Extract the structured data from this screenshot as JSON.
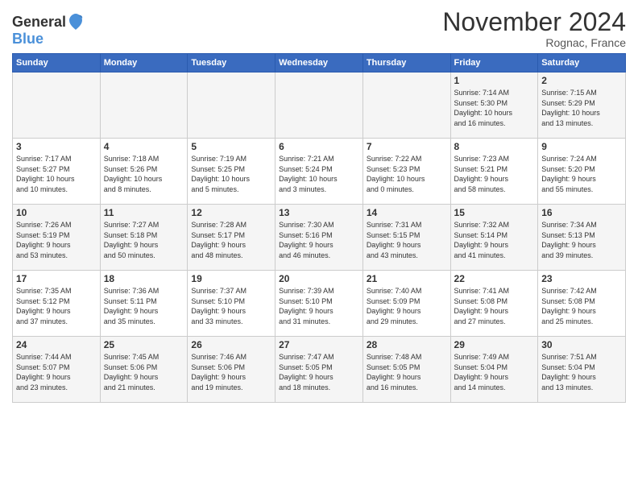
{
  "header": {
    "logo_general": "General",
    "logo_blue": "Blue",
    "title": "November 2024",
    "location": "Rognac, France"
  },
  "weekdays": [
    "Sunday",
    "Monday",
    "Tuesday",
    "Wednesday",
    "Thursday",
    "Friday",
    "Saturday"
  ],
  "weeks": [
    [
      {
        "day": "",
        "info": ""
      },
      {
        "day": "",
        "info": ""
      },
      {
        "day": "",
        "info": ""
      },
      {
        "day": "",
        "info": ""
      },
      {
        "day": "",
        "info": ""
      },
      {
        "day": "1",
        "info": "Sunrise: 7:14 AM\nSunset: 5:30 PM\nDaylight: 10 hours\nand 16 minutes."
      },
      {
        "day": "2",
        "info": "Sunrise: 7:15 AM\nSunset: 5:29 PM\nDaylight: 10 hours\nand 13 minutes."
      }
    ],
    [
      {
        "day": "3",
        "info": "Sunrise: 7:17 AM\nSunset: 5:27 PM\nDaylight: 10 hours\nand 10 minutes."
      },
      {
        "day": "4",
        "info": "Sunrise: 7:18 AM\nSunset: 5:26 PM\nDaylight: 10 hours\nand 8 minutes."
      },
      {
        "day": "5",
        "info": "Sunrise: 7:19 AM\nSunset: 5:25 PM\nDaylight: 10 hours\nand 5 minutes."
      },
      {
        "day": "6",
        "info": "Sunrise: 7:21 AM\nSunset: 5:24 PM\nDaylight: 10 hours\nand 3 minutes."
      },
      {
        "day": "7",
        "info": "Sunrise: 7:22 AM\nSunset: 5:23 PM\nDaylight: 10 hours\nand 0 minutes."
      },
      {
        "day": "8",
        "info": "Sunrise: 7:23 AM\nSunset: 5:21 PM\nDaylight: 9 hours\nand 58 minutes."
      },
      {
        "day": "9",
        "info": "Sunrise: 7:24 AM\nSunset: 5:20 PM\nDaylight: 9 hours\nand 55 minutes."
      }
    ],
    [
      {
        "day": "10",
        "info": "Sunrise: 7:26 AM\nSunset: 5:19 PM\nDaylight: 9 hours\nand 53 minutes."
      },
      {
        "day": "11",
        "info": "Sunrise: 7:27 AM\nSunset: 5:18 PM\nDaylight: 9 hours\nand 50 minutes."
      },
      {
        "day": "12",
        "info": "Sunrise: 7:28 AM\nSunset: 5:17 PM\nDaylight: 9 hours\nand 48 minutes."
      },
      {
        "day": "13",
        "info": "Sunrise: 7:30 AM\nSunset: 5:16 PM\nDaylight: 9 hours\nand 46 minutes."
      },
      {
        "day": "14",
        "info": "Sunrise: 7:31 AM\nSunset: 5:15 PM\nDaylight: 9 hours\nand 43 minutes."
      },
      {
        "day": "15",
        "info": "Sunrise: 7:32 AM\nSunset: 5:14 PM\nDaylight: 9 hours\nand 41 minutes."
      },
      {
        "day": "16",
        "info": "Sunrise: 7:34 AM\nSunset: 5:13 PM\nDaylight: 9 hours\nand 39 minutes."
      }
    ],
    [
      {
        "day": "17",
        "info": "Sunrise: 7:35 AM\nSunset: 5:12 PM\nDaylight: 9 hours\nand 37 minutes."
      },
      {
        "day": "18",
        "info": "Sunrise: 7:36 AM\nSunset: 5:11 PM\nDaylight: 9 hours\nand 35 minutes."
      },
      {
        "day": "19",
        "info": "Sunrise: 7:37 AM\nSunset: 5:10 PM\nDaylight: 9 hours\nand 33 minutes."
      },
      {
        "day": "20",
        "info": "Sunrise: 7:39 AM\nSunset: 5:10 PM\nDaylight: 9 hours\nand 31 minutes."
      },
      {
        "day": "21",
        "info": "Sunrise: 7:40 AM\nSunset: 5:09 PM\nDaylight: 9 hours\nand 29 minutes."
      },
      {
        "day": "22",
        "info": "Sunrise: 7:41 AM\nSunset: 5:08 PM\nDaylight: 9 hours\nand 27 minutes."
      },
      {
        "day": "23",
        "info": "Sunrise: 7:42 AM\nSunset: 5:08 PM\nDaylight: 9 hours\nand 25 minutes."
      }
    ],
    [
      {
        "day": "24",
        "info": "Sunrise: 7:44 AM\nSunset: 5:07 PM\nDaylight: 9 hours\nand 23 minutes."
      },
      {
        "day": "25",
        "info": "Sunrise: 7:45 AM\nSunset: 5:06 PM\nDaylight: 9 hours\nand 21 minutes."
      },
      {
        "day": "26",
        "info": "Sunrise: 7:46 AM\nSunset: 5:06 PM\nDaylight: 9 hours\nand 19 minutes."
      },
      {
        "day": "27",
        "info": "Sunrise: 7:47 AM\nSunset: 5:05 PM\nDaylight: 9 hours\nand 18 minutes."
      },
      {
        "day": "28",
        "info": "Sunrise: 7:48 AM\nSunset: 5:05 PM\nDaylight: 9 hours\nand 16 minutes."
      },
      {
        "day": "29",
        "info": "Sunrise: 7:49 AM\nSunset: 5:04 PM\nDaylight: 9 hours\nand 14 minutes."
      },
      {
        "day": "30",
        "info": "Sunrise: 7:51 AM\nSunset: 5:04 PM\nDaylight: 9 hours\nand 13 minutes."
      }
    ]
  ]
}
